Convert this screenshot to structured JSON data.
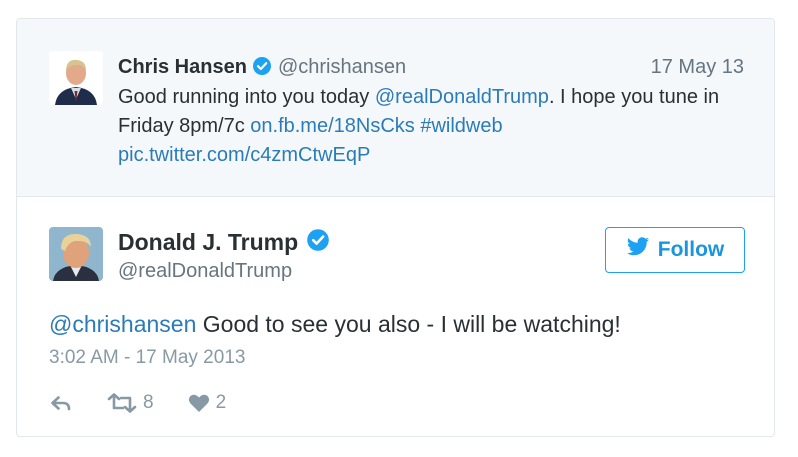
{
  "quoted_tweet": {
    "name": "Chris Hansen",
    "handle": "@chrishansen",
    "date": "17 May 13",
    "text_before": "Good running into you today ",
    "mention": "@realDonaldTrump",
    "text_after": ". I hope you tune in Friday 8pm/7c ",
    "link": "on.fb.me/18NsCks",
    "hashtag": "#wildweb",
    "pic_link": "pic.twitter.com/c4zmCtwEqP"
  },
  "tweet": {
    "name": "Donald J. Trump",
    "handle": "@realDonaldTrump",
    "follow_label": "Follow",
    "reply_mention": "@chrishansen",
    "text": " Good to see you also - I will be watching!",
    "timestamp": "3:02 AM - 17 May 2013",
    "retweets": "8",
    "likes": "2"
  },
  "colors": {
    "link": "#2b7bb9",
    "verified": "#1da1f2",
    "muted": "#8899a6"
  },
  "icons": [
    "verified-badge-icon",
    "bird-icon",
    "reply-icon",
    "retweet-icon",
    "heart-icon"
  ]
}
